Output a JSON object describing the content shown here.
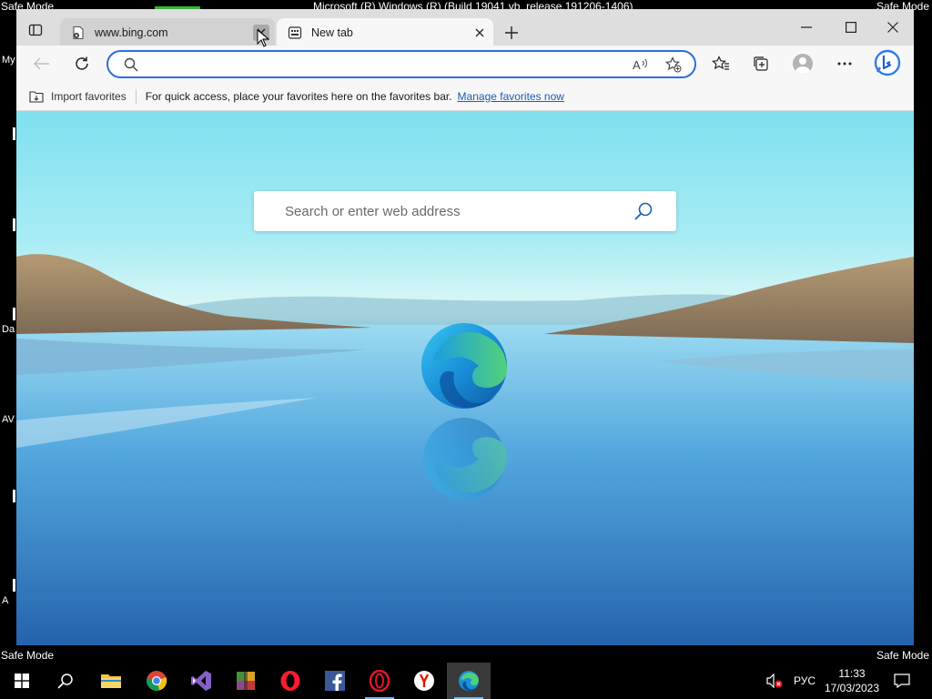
{
  "desktop": {
    "safe_mode_label": "Safe Mode",
    "os_build": "Microsoft (R) Windows (R) (Build 19041.vb_release.191206-1406)",
    "fragments": {
      "my": "My",
      "da": "Da",
      "av": "AV",
      "a": "A"
    }
  },
  "browser": {
    "tabs": [
      {
        "title": "www.bing.com",
        "favicon": "page-error-icon",
        "close_label": "×"
      },
      {
        "title": "New tab",
        "favicon": "new-tab-page-icon",
        "close_label": "×"
      }
    ],
    "address_bar": {
      "value": "",
      "placeholder": ""
    },
    "favorites_bar": {
      "import_label": "Import favorites",
      "message": "For quick access, place your favorites here on the favorites bar.",
      "manage_link": "Manage favorites now"
    },
    "ntp": {
      "search_placeholder": "Search or enter web address"
    },
    "accent": "#2c6fdd"
  },
  "taskbar": {
    "apps": [
      "file-explorer-icon",
      "chrome-icon",
      "visual-studio-icon",
      "winrar-icon",
      "opera-icon",
      "facebook-icon",
      "opera-gx-icon",
      "yandex-icon",
      "edge-icon"
    ],
    "language": "РУС",
    "time": "11:33",
    "date": "17/03/2023"
  }
}
